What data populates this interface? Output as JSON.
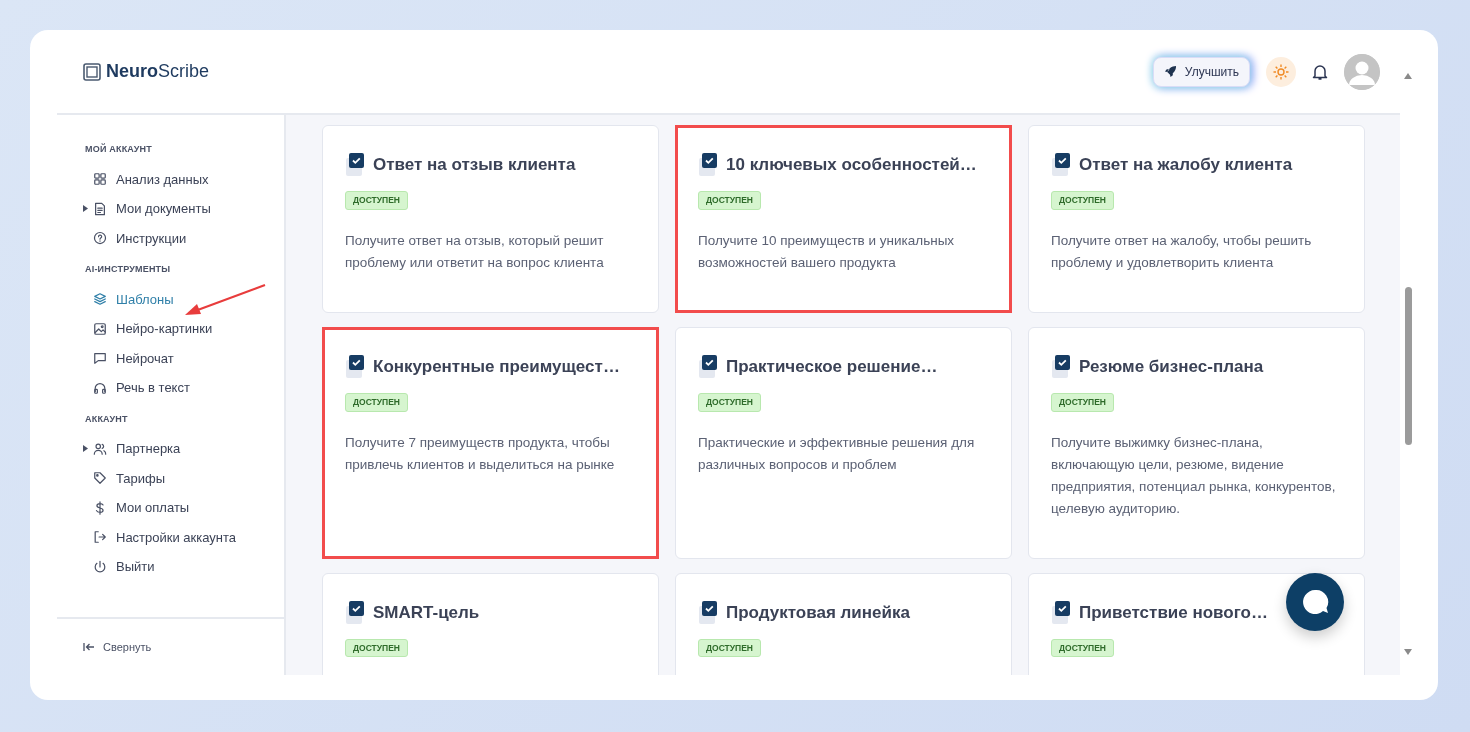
{
  "logo": {
    "bold": "Neuro",
    "regular": "Scribe"
  },
  "header": {
    "upgrade_button": "Улучшить"
  },
  "sidebar": {
    "sections": [
      {
        "heading": "МОЙ АККАУНТ",
        "items": [
          {
            "label": "Анализ данных",
            "kind": "grid",
            "expandable": false,
            "selected": false,
            "callout_arrow": false
          },
          {
            "label": "Мои документы",
            "kind": "document",
            "expandable": true,
            "selected": false,
            "callout_arrow": false
          },
          {
            "label": "Инструкции",
            "kind": "help",
            "expandable": false,
            "selected": false,
            "callout_arrow": false
          }
        ]
      },
      {
        "heading": "AI-ИНСТРУМЕНТЫ",
        "items": [
          {
            "label": "Шаблоны",
            "kind": "layers",
            "expandable": false,
            "selected": true,
            "callout_arrow": true
          },
          {
            "label": "Нейро-картинки",
            "kind": "image",
            "expandable": false,
            "selected": false,
            "callout_arrow": false
          },
          {
            "label": "Нейрочат",
            "kind": "chat",
            "expandable": false,
            "selected": false,
            "callout_arrow": false
          },
          {
            "label": "Речь в текст",
            "kind": "headphones",
            "expandable": false,
            "selected": false,
            "callout_arrow": false
          }
        ]
      },
      {
        "heading": "АККАУНТ",
        "items": [
          {
            "label": "Партнерка",
            "kind": "users",
            "expandable": true,
            "selected": false,
            "callout_arrow": false
          },
          {
            "label": "Тарифы",
            "kind": "tag",
            "expandable": false,
            "selected": false,
            "callout_arrow": false
          },
          {
            "label": "Мои оплаты",
            "kind": "dollar",
            "expandable": false,
            "selected": false,
            "callout_arrow": false
          },
          {
            "label": "Настройки аккаунта",
            "kind": "logout",
            "expandable": false,
            "selected": false,
            "callout_arrow": false
          },
          {
            "label": "Выйти",
            "kind": "power",
            "expandable": false,
            "selected": false,
            "callout_arrow": false
          }
        ]
      }
    ],
    "collapse": "Свернуть"
  },
  "templates": [
    {
      "title": "Ответ на отзыв клиента",
      "badge": "ДОСТУПЕН",
      "description": "Получите ответ на отзыв, который решит проблему или ответит на вопрос клиента",
      "highlighted": false
    },
    {
      "title": "10 ключевых особенностей…",
      "badge": "ДОСТУПЕН",
      "description": "Получите 10 преимуществ и уникальных возможностей вашего продукта",
      "highlighted": true
    },
    {
      "title": "Ответ на жалобу клиента",
      "badge": "ДОСТУПЕН",
      "description": "Получите ответ на жалобу, чтобы решить проблему и удовлетворить клиента",
      "highlighted": false
    },
    {
      "title": "Конкурентные преимущест…",
      "badge": "ДОСТУПЕН",
      "description": "Получите 7 преимуществ продукта, чтобы привлечь клиентов и выделиться на рынке",
      "highlighted": true
    },
    {
      "title": "Практическое решение…",
      "badge": "ДОСТУПЕН",
      "description": "Практические и эффективные решения для различных вопросов и проблем",
      "highlighted": false
    },
    {
      "title": "Резюме бизнес-плана",
      "badge": "ДОСТУПЕН",
      "description": "Получите выжимку бизнес-плана, включающую цели, резюме, видение предприятия, потенциал рынка, конкурентов, целевую аудиторию.",
      "highlighted": false
    },
    {
      "title": "SMART-цель",
      "badge": "ДОСТУПЕН",
      "highlighted": false
    },
    {
      "title": "Продуктовая линейка",
      "badge": "ДОСТУПЕН",
      "highlighted": false
    },
    {
      "title": "Приветствие нового…",
      "badge": "ДОСТУПЕН",
      "highlighted": false
    }
  ]
}
